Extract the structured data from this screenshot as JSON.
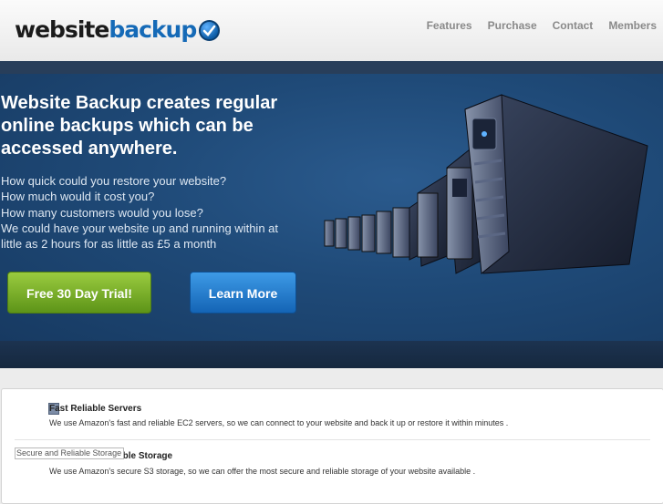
{
  "logo": {
    "text_dark": "website",
    "text_blue": "backup"
  },
  "nav": {
    "items": [
      "Features",
      "Purchase",
      "Contact",
      "Members"
    ]
  },
  "hero": {
    "headline": "Website Backup creates regular online backups which can be accessed anywhere.",
    "lines": [
      "How quick could you restore your website?",
      "How much would it cost you?",
      "How many customers would you lose?",
      "We could have your website up and running within at",
      "little as 2 hours for as little as £5 a month"
    ],
    "trial_button": "Free 30 Day Trial!",
    "learn_button": "Learn More"
  },
  "features": [
    {
      "title": "Fast Reliable Servers",
      "description": "We use Amazon's fast and reliable EC2 servers, so we can connect to your website and back it up or restore it within minutes ."
    },
    {
      "title": "Secure and Reliable Storage",
      "description": "We use Amazon's secure S3 storage, so we can offer the most secure and reliable storage of your website available ."
    }
  ],
  "broken_image_alt": "Secure and Reliable Storage",
  "colors": {
    "brand_blue": "#156ab7",
    "green_button": "#6fa623",
    "blue_button": "#1f78cc",
    "hero_bg": "#1f4a78"
  }
}
